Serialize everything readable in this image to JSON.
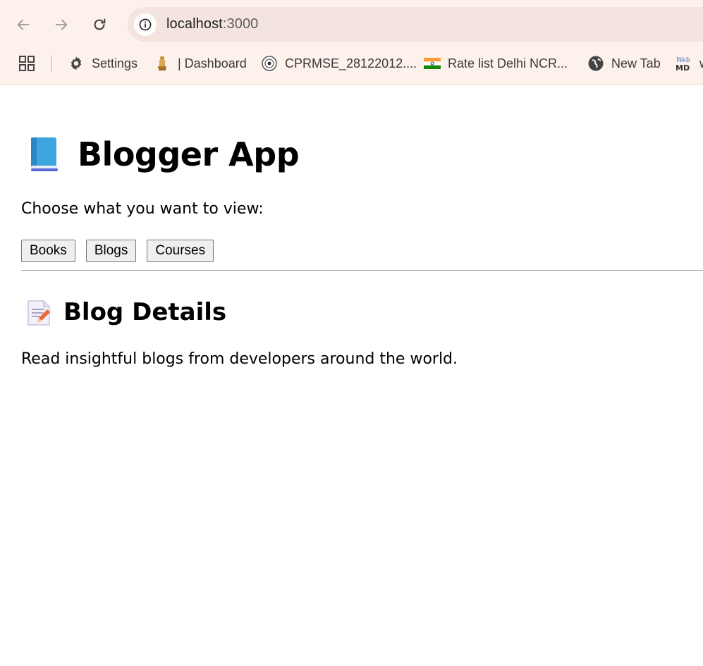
{
  "browser": {
    "url_host": "localhost",
    "url_port": ":3000",
    "bookmarks": [
      {
        "label": "Settings",
        "icon": "gear-icon"
      },
      {
        "label": "| Dashboard",
        "icon": "emblem-icon"
      },
      {
        "label": "CPRMSE_28122012....",
        "icon": "seal-icon"
      },
      {
        "label": "Rate list Delhi NCR...",
        "icon": "india-flag-icon"
      },
      {
        "label": "New Tab",
        "icon": "globe-icon"
      },
      {
        "label": "w",
        "icon": "webmd-icon"
      }
    ]
  },
  "app": {
    "title": "Blogger App",
    "prompt": "Choose what you want to view:",
    "buttons": [
      "Books",
      "Blogs",
      "Courses"
    ],
    "section_title": "Blog Details",
    "section_text": "Read insightful blogs from developers around the world."
  }
}
